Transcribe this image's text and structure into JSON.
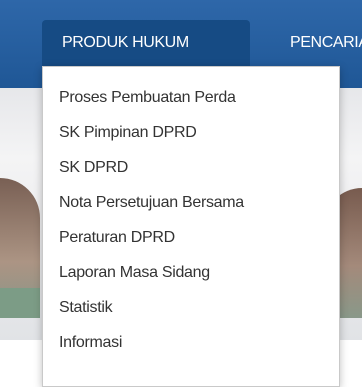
{
  "nav": {
    "items": [
      {
        "label": "PRODUK HUKUM",
        "active": true
      },
      {
        "label": "PENCARIAN"
      }
    ]
  },
  "dropdown": {
    "items": [
      {
        "label": "Proses Pembuatan Perda"
      },
      {
        "label": "SK Pimpinan DPRD"
      },
      {
        "label": "SK DPRD"
      },
      {
        "label": "Nota Persetujuan Bersama"
      },
      {
        "label": "Peraturan DPRD"
      },
      {
        "label": "Laporan Masa Sidang"
      },
      {
        "label": "Statistik"
      },
      {
        "label": "Informasi"
      }
    ]
  },
  "colors": {
    "navbar": "#2561a1",
    "active_tab": "#164b84",
    "menu_text": "#333333"
  }
}
